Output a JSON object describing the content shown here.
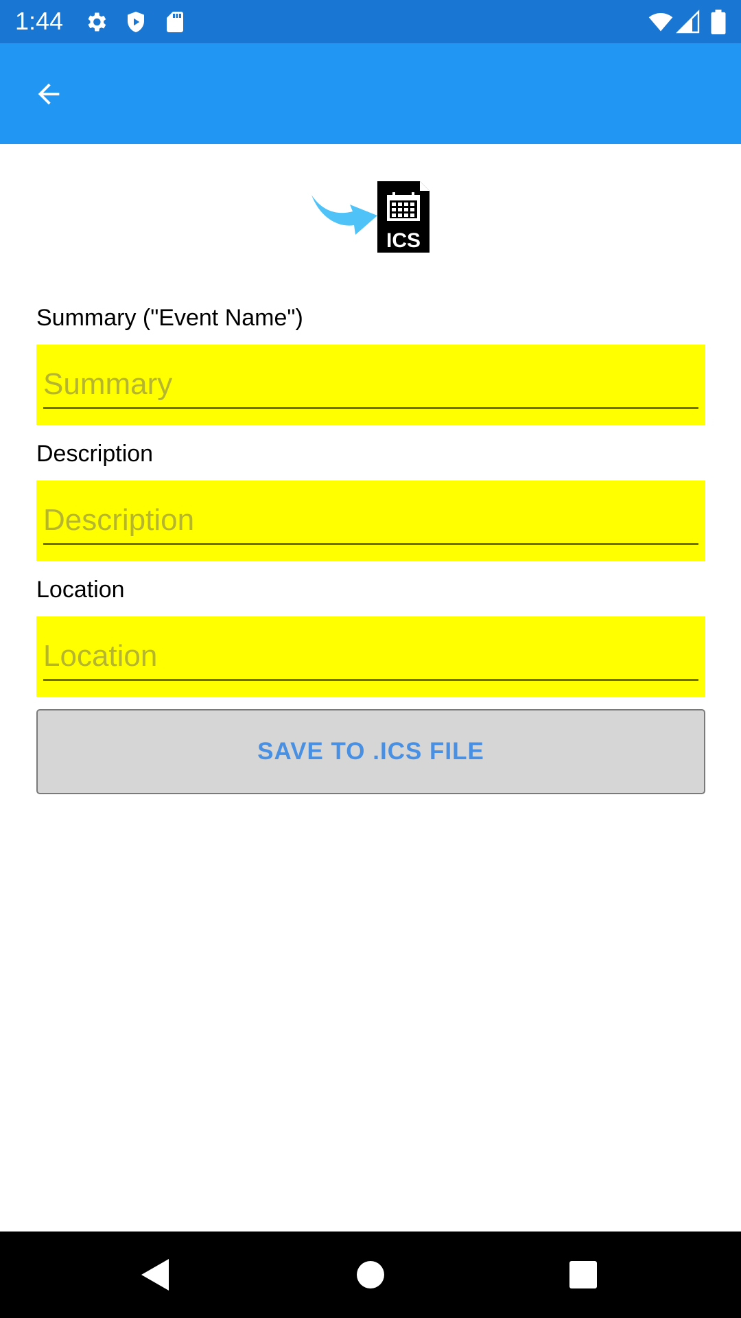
{
  "status_bar": {
    "time": "1:44",
    "icons": [
      "settings-icon",
      "shield-play-icon",
      "sd-card-icon",
      "wifi-icon",
      "signal-icon",
      "battery-icon"
    ]
  },
  "app_bar": {
    "back_icon": "arrow-back-icon",
    "color": "#2196f3"
  },
  "hero": {
    "icon": "ics-file-import-icon",
    "text": "ICS"
  },
  "form": {
    "summary": {
      "label": "Summary (\"Event Name\")",
      "placeholder": "Summary",
      "value": ""
    },
    "description": {
      "label": "Description",
      "placeholder": "Description",
      "value": ""
    },
    "location": {
      "label": "Location",
      "placeholder": "Location",
      "value": ""
    },
    "field_background": "#ffff00"
  },
  "save_button": {
    "label": "SAVE TO .ICS FILE",
    "text_color": "#4a90e2"
  },
  "nav_bar": {
    "buttons": [
      "back-triangle-icon",
      "home-circle-icon",
      "recents-square-icon"
    ]
  }
}
